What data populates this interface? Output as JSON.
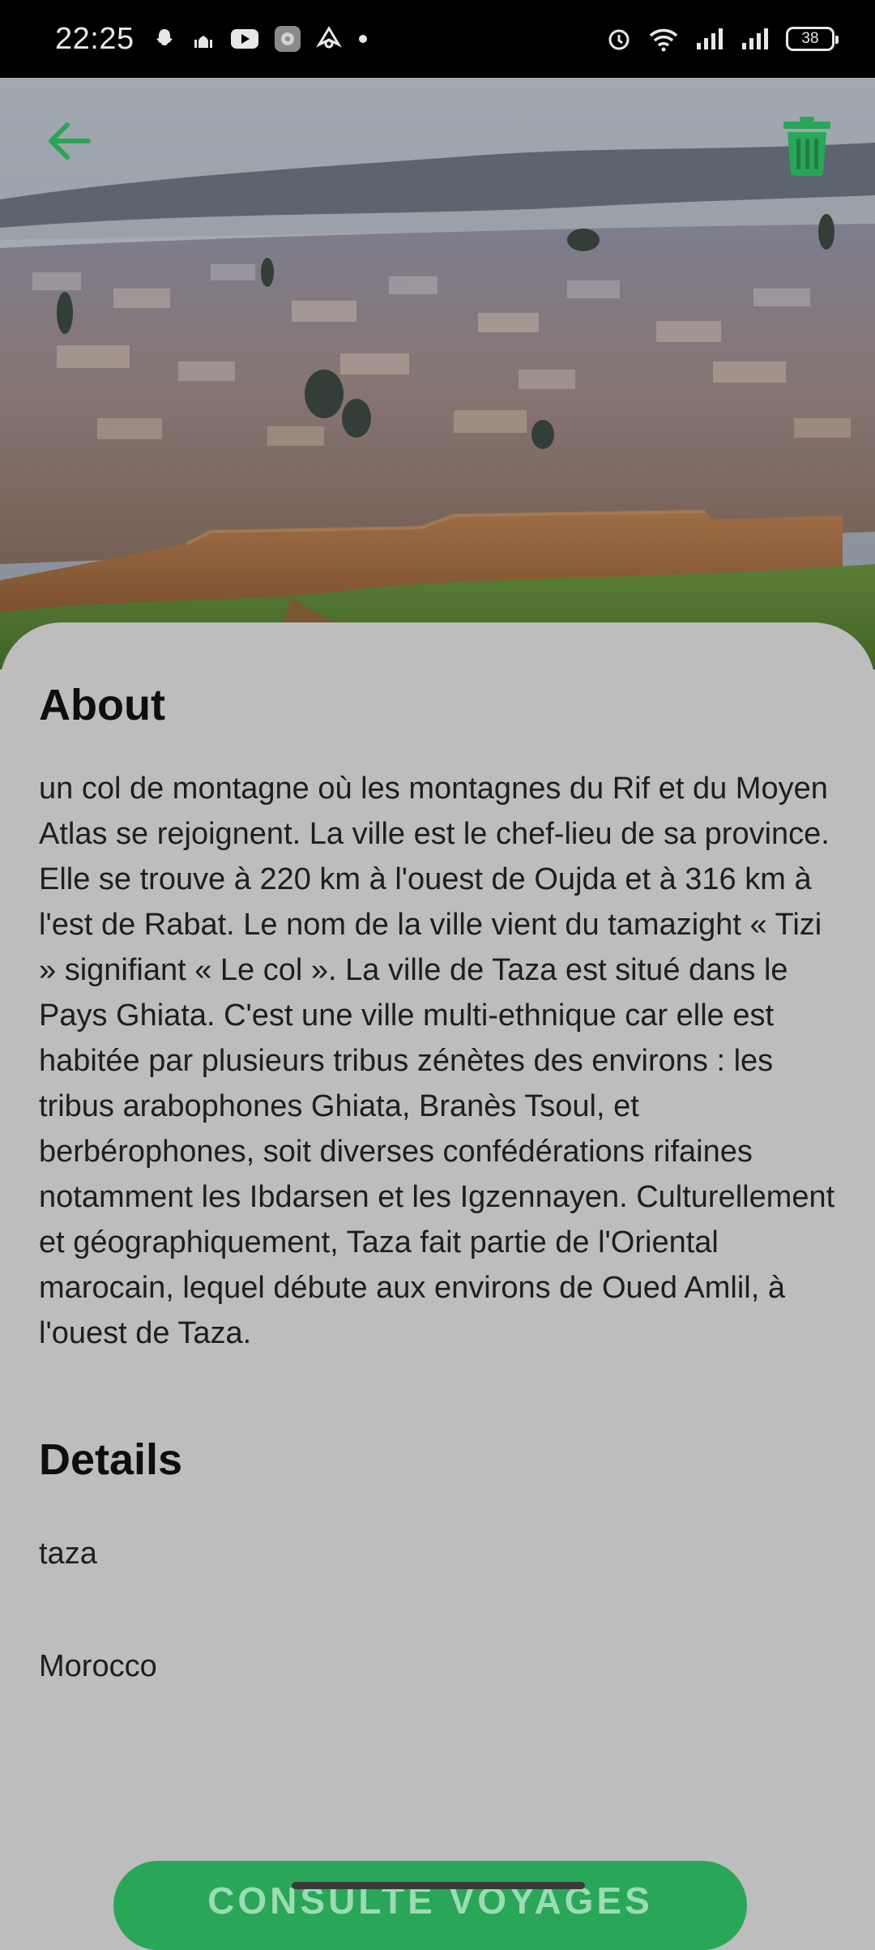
{
  "status_bar": {
    "time": "22:25",
    "battery": "38",
    "left_icons": [
      "snapchat-icon",
      "mosque-icon",
      "youtube-icon",
      "settings-app-icon",
      "nav-app-icon",
      "dot-icon"
    ],
    "right_icons": [
      "alarm-icon",
      "wifi-icon",
      "signal-icon",
      "signal-icon"
    ]
  },
  "header": {
    "back_icon": "arrow-left-icon",
    "delete_icon": "trash-icon",
    "accent_color": "#2aa658"
  },
  "about": {
    "title": "About",
    "text": "un col de montagne où les montagnes du Rif et du Moyen Atlas se rejoignent. La ville est le chef-lieu de sa province. Elle se trouve à 220 km à l'ouest de Oujda et à 316 km à l'est de Rabat. Le nom de la ville vient du tamazight « Tizi » signifiant « Le col ». La ville de Taza est situé dans le Pays Ghiata. C'est une ville multi-ethnique car elle est habitée par plusieurs tribus zénètes des environs : les tribus arabophones Ghiata, Branès Tsoul, et berbérophones, soit diverses confédérations rifaines notamment les Ibdarsen et les Igzennayen. Culturellement et géographiquement, Taza fait partie de l'Oriental marocain, lequel débute aux environs de Oued Amlil, à l'ouest de Taza."
  },
  "details": {
    "title": "Details",
    "city": "taza",
    "country": "Morocco"
  },
  "action": {
    "label": "CONSULTE VOYAGES"
  }
}
